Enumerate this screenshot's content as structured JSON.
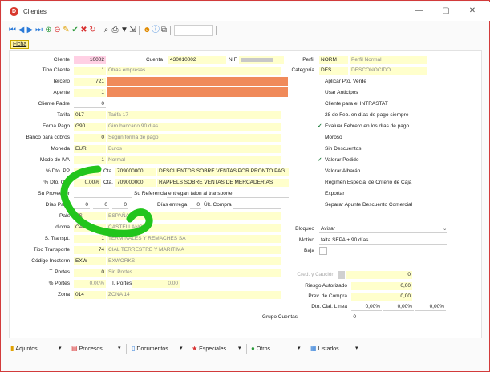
{
  "window": {
    "title": "Clientes",
    "app_icon": "D",
    "min": "—",
    "max": "▢",
    "close": "✕"
  },
  "toolbar_icons": [
    "first-icon",
    "prev-icon",
    "next-icon",
    "last-icon",
    "add-icon",
    "delete-icon",
    "edit-icon",
    "confirm-icon",
    "cancel-icon",
    "refresh-icon",
    "search-icon",
    "print-icon",
    "filter-icon",
    "export-icon",
    "user-icon",
    "info-icon",
    "copy-icon"
  ],
  "tab": {
    "label": "Ficha"
  },
  "form": {
    "cliente": {
      "label": "Cliente",
      "value": "10002"
    },
    "cuenta": {
      "label": "Cuenta",
      "value": "430010002"
    },
    "nif": {
      "label": "NIF"
    },
    "tipo_cliente": {
      "label": "Tipo Cliente",
      "value": "1",
      "desc": "Otras empresas"
    },
    "tercero": {
      "label": "Tercero",
      "value": "721"
    },
    "agente": {
      "label": "Agente",
      "value": "1"
    },
    "cliente_padre": {
      "label": "Cliente Padre",
      "value": "0"
    },
    "tarifa": {
      "label": "Tarifa",
      "value": "017",
      "desc": "Tarifa 17"
    },
    "forma_pago": {
      "label": "Forna Pago",
      "value": "G90",
      "desc": "Giro bancario 90 días"
    },
    "banco": {
      "label": "Banco para cobros",
      "value": "0",
      "desc": "Segun forma de pago"
    },
    "moneda": {
      "label": "Moneda",
      "value": "EUR",
      "desc": "Euros"
    },
    "modo_iva": {
      "label": "Modo de IVA",
      "value": "1",
      "desc": "Normal"
    },
    "dto_pp": {
      "label": "% Dto. PP",
      "pct": "0,00%",
      "cta_label": "Cta.",
      "cta": "709000000",
      "desc": "DESCUENTOS SOBRE VENTAS POR PRONTO PAG"
    },
    "dto_cial": {
      "label": "% Dto. Cial",
      "pct": "0,00%",
      "cta_label": "Cta.",
      "cta": "709000000",
      "desc": "RAPPELS SOBRE VENTAS DE MERCADERIAS"
    },
    "su_proveedor": {
      "label": "Su Proveedor",
      "su_ref_label": "Su Referencia",
      "su_ref": "entregan talon al transporte"
    },
    "dias_pago": {
      "label": "Días Pago",
      "d1": "0",
      "d2": "0",
      "d3": "0",
      "dias_entrega_label": "Días entrega",
      "dias_entrega": "0",
      "ult_compra_label": "Últ. Compra"
    },
    "pais": {
      "label": "País",
      "value": "ES",
      "desc": "ESPAÑA"
    },
    "idioma": {
      "label": "Idioma",
      "value": "CAS",
      "desc": "CASTELLANO"
    },
    "transpt": {
      "label": "S. Transpt.",
      "value": "1",
      "desc": "TERMINALES Y REMACHES SA"
    },
    "tipo_transporte": {
      "label": "Tipo Transporte",
      "value": "74",
      "desc": "CIAL TERRESTRE Y MARITIMA"
    },
    "incoterm": {
      "label": "Código Incoterm",
      "value": "EXW",
      "desc": "EXWORKS"
    },
    "portes": {
      "label": "T. Portes",
      "value": "0",
      "desc": "Sin Portes"
    },
    "pct_portes": {
      "label": "% Portes",
      "value": "0,00%",
      "i_portes_label": "I. Portes",
      "i_portes": "0,00"
    },
    "zona": {
      "label": "Zona",
      "value": "014",
      "desc": "ZONA 14"
    }
  },
  "right": {
    "perfil": {
      "label": "Perfil",
      "value": "NORM",
      "desc": "Perfil Normal"
    },
    "categoria": {
      "label": "Categoría",
      "value": "DES",
      "desc": "DESCONOCIDO"
    },
    "checks": [
      {
        "label": "Aplicar Pto. Verde",
        "checked": false
      },
      {
        "label": "Usar Anticipos",
        "checked": false
      },
      {
        "label": "Cliente para el INTRASTAT",
        "checked": false
      },
      {
        "label": "28 de Feb. en días de pago siempre",
        "checked": false
      },
      {
        "label": "Evaluar Febrero en los días de pago",
        "checked": true
      },
      {
        "label": "Moroso",
        "checked": false
      },
      {
        "label": "Sin Descuentos",
        "checked": false
      },
      {
        "label": "Valorar Pedido",
        "checked": true
      },
      {
        "label": "Valorar Albarán",
        "checked": false
      },
      {
        "label": "Régimen Especial de Criterio de Caja",
        "checked": false
      },
      {
        "label": "Exportar",
        "checked": false
      },
      {
        "label": "Separar Apunte Descuento Comercial",
        "checked": false
      }
    ],
    "bloqueo": {
      "label": "Bloqueo",
      "value": "Avisar"
    },
    "motivo": {
      "label": "Motivo",
      "value": "falta SEPA + 90 días"
    },
    "baja": {
      "label": "Baja"
    },
    "cred_caucion": {
      "label": "Cred. y Caución",
      "value": "0"
    },
    "riesgo": {
      "label": "Riesgo Autorizado",
      "value": "0,00"
    },
    "prev_compra": {
      "label": "Prev. de Compra",
      "value": "0,00"
    },
    "dto_cial_linea": {
      "label": "Dto. Cial. Línea",
      "v1": "0,00%",
      "v2": "0,00%",
      "v3": "0,00%"
    },
    "grupo_cuentas": {
      "label": "Grupo Cuentas",
      "value": "0"
    }
  },
  "bottom": {
    "adjuntos": "Adjuntos",
    "procesos": "Procesos",
    "documentos": "Documentos",
    "especiales": "Especiales",
    "otros": "Otros",
    "listados": "Listados"
  },
  "colors": {
    "field_bg": "#ffffcc",
    "highlight_pink": "#ffd0e4",
    "redaction": "#f08a5a",
    "accent_red": "#d8382d",
    "highlight_stroke": "#22c51c"
  }
}
